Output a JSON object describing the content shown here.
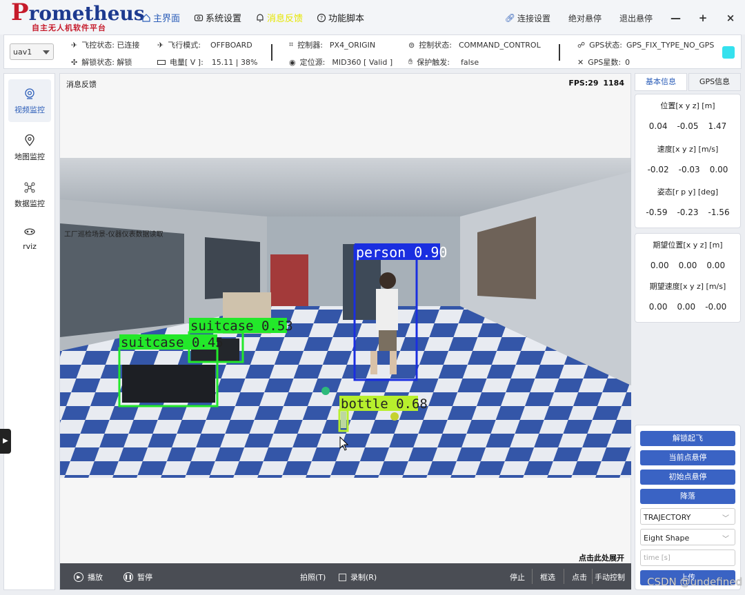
{
  "app": {
    "logo_text": "Prometheus",
    "logo_sub": "自主无人机软件平台"
  },
  "nav": [
    {
      "label": "主界面",
      "icon": "home-icon"
    },
    {
      "label": "系统设置",
      "icon": "settings-icon"
    },
    {
      "label": "消息反馈",
      "icon": "bell-icon"
    },
    {
      "label": "功能脚本",
      "icon": "help-icon"
    }
  ],
  "title_actions": {
    "connect": "连接设置",
    "hover_abs": "绝对悬停",
    "exit_hover": "退出悬停",
    "minimize": "—",
    "maximize": "+",
    "close": "×"
  },
  "status": {
    "uav_select": "uav1",
    "fc_state": "飞控状态: 已连接",
    "arm_state": "解锁状态: 解锁",
    "flight_mode_label": "飞行模式:",
    "flight_mode": "OFFBOARD",
    "battery_label": "电量[ V ]:",
    "battery": "15.11 | 38%",
    "controller_label": "控制器:",
    "controller": "PX4_ORIGIN",
    "loc_src_label": "定位源:",
    "loc_src": "MID360 [ Valid ]",
    "ctrl_state_label": "控制状态:",
    "ctrl_state": "COMMAND_CONTROL",
    "protect_label": "保护触发:",
    "protect": "false",
    "gps_state_label": "GPS状态:",
    "gps_state": "GPS_FIX_TYPE_NO_GPS",
    "gps_sats_label": "GPS星数:",
    "gps_sats": "0"
  },
  "sidebar": [
    {
      "label": "视频监控",
      "icon": "camera-icon"
    },
    {
      "label": "地图监控",
      "icon": "map-pin-icon"
    },
    {
      "label": "数据监控",
      "icon": "network-icon"
    },
    {
      "label": "rviz",
      "icon": "rviz-icon"
    }
  ],
  "main": {
    "header_left": "消息反馈",
    "fps": "FPS:29  1184",
    "expand_hint": "点击此处展开",
    "detections": [
      {
        "label": "person 0.90",
        "color": "#1a2ee0"
      },
      {
        "label": "suitcase 0.53",
        "color": "#23e82a"
      },
      {
        "label": "suitcase 0.45",
        "color": "#23e82a"
      },
      {
        "label": "bottle 0.68",
        "color": "#b7ef2d"
      }
    ],
    "scene_text": "工厂巡检场景-仪器仪表数据读取"
  },
  "controls": {
    "play": "播放",
    "pause": "暂停",
    "snapshot": "拍照(T)",
    "record": "录制(R)",
    "stop": "停止",
    "box_select": "框选",
    "click_point": "点击",
    "manual": "手动控制"
  },
  "right": {
    "tabs": [
      "基本信息",
      "GPS信息"
    ],
    "pos_label": "位置[x y z] [m]",
    "pos": [
      "0.04",
      "-0.05",
      "1.47"
    ],
    "vel_label": "速度[x y z] [m/s]",
    "vel": [
      "-0.02",
      "-0.03",
      "0.00"
    ],
    "att_label": "姿态[r p y] [deg]",
    "att": [
      "-0.59",
      "-0.23",
      "-1.56"
    ],
    "des_pos_label": "期望位置[x y z] [m]",
    "des_pos": [
      "0.00",
      "0.00",
      "0.00"
    ],
    "des_vel_label": "期望速度[x y z] [m/s]",
    "des_vel": [
      "0.00",
      "0.00",
      "-0.00"
    ],
    "buttons": [
      "解锁起飞",
      "当前点悬停",
      "初始点悬停",
      "降落"
    ],
    "traj_select": "TRAJECTORY",
    "shape_select": "Eight Shape",
    "time_placeholder": "time [s]",
    "upload": "上传"
  },
  "watermark": "CSDN @undefined",
  "colors": {
    "accent": "#2b5db8",
    "button": "#3a63c4",
    "status_cyan": "#35e1ee"
  }
}
